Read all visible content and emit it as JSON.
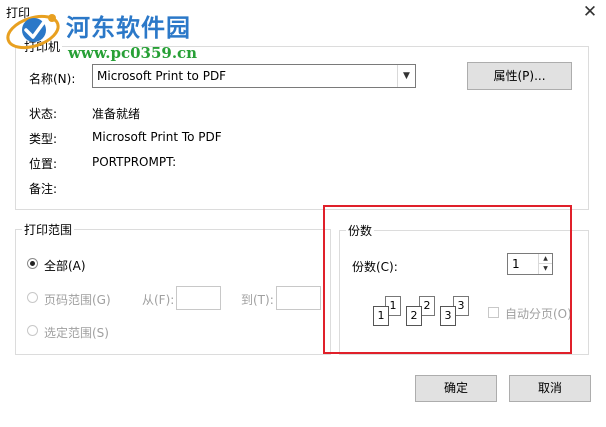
{
  "window": {
    "title": "打印",
    "close_glyph": "✕"
  },
  "watermark": {
    "site_name": "河东软件园",
    "url": "www.pc0359.cn"
  },
  "printer": {
    "group_label": "打印机",
    "name_label": "名称(N):",
    "name_value": "Microsoft Print to PDF",
    "properties_button": "属性(P)...",
    "status_label": "状态:",
    "status_value": "准备就绪",
    "type_label": "类型:",
    "type_value": "Microsoft Print To PDF",
    "location_label": "位置:",
    "location_value": "PORTPROMPT:",
    "comment_label": "备注:"
  },
  "print_range": {
    "group_label": "打印范围",
    "all_label": "全部(A)",
    "pages_label": "页码范围(G)",
    "from_label": "从(F):",
    "to_label": "到(T):",
    "selection_label": "选定范围(S)",
    "selected": "all"
  },
  "copies": {
    "group_label": "份数",
    "count_label": "份数(C):",
    "count_value": "1",
    "collate_label": "自动分页(O)",
    "collate_checked": false,
    "page_numbers": [
      "1",
      "1",
      "2",
      "2",
      "3",
      "3"
    ]
  },
  "buttons": {
    "ok": "确定",
    "cancel": "取消"
  },
  "colors": {
    "highlight_box": "#e0202a",
    "watermark_blue": "#2b78c8",
    "watermark_green": "#27a036"
  }
}
